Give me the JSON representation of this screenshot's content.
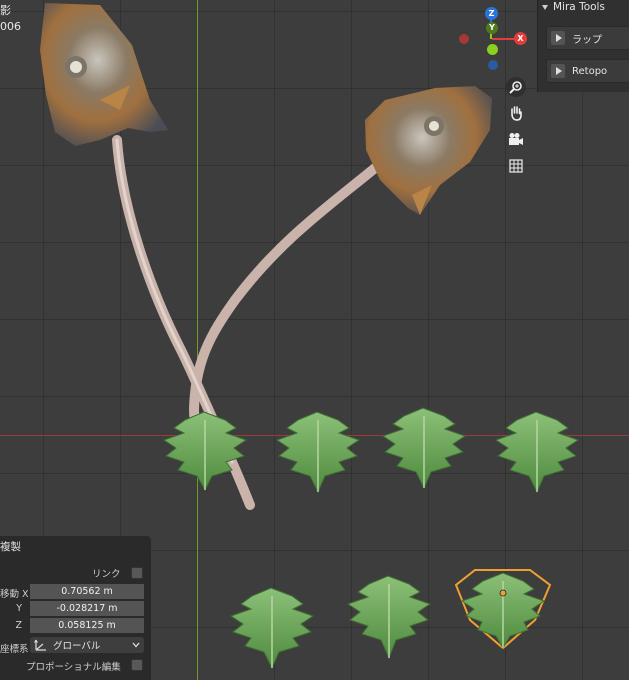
{
  "viewport": {
    "object_label": "影",
    "frame_label": "006"
  },
  "gizmo": {
    "x_label": "X",
    "y_label": "Y",
    "z_label": "Z",
    "x_color": "#e23c3c",
    "y_color": "#8ccf20",
    "z_color": "#2c74d9"
  },
  "mira_tools": {
    "title": "Mira Tools",
    "buttons": [
      {
        "label": "ラップ"
      },
      {
        "label": "Retopo"
      }
    ]
  },
  "redo_panel": {
    "title": "複製",
    "link_label": "リンク",
    "move_x_label": "移動 X",
    "y_label": "Y",
    "z_label": "Z",
    "move_x_value": "0.70562 m",
    "move_y_value": "-0.028217 m",
    "move_z_value": "0.058125 m",
    "orientation_label": "座標系",
    "orientation_value": "グローバル",
    "proportional_label": "プロポーショナル編集"
  },
  "colors": {
    "selection_outline": "#f0a030",
    "viewport_bg": "#3d3d3d",
    "leaf_green": "#6fa85a"
  }
}
